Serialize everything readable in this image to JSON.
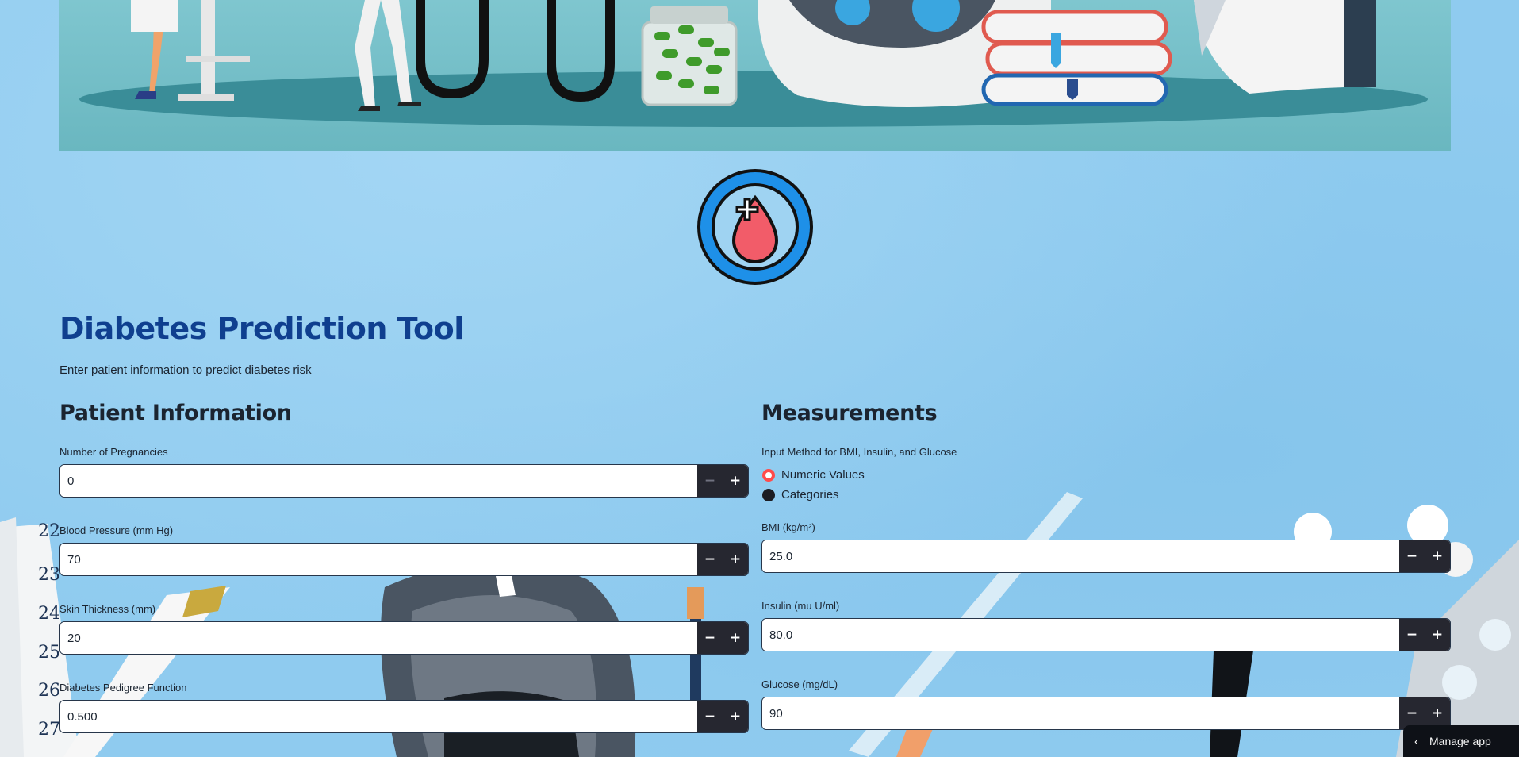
{
  "header": {
    "title": "Diabetes Prediction Tool",
    "subtitle": "Enter patient information to predict diabetes risk"
  },
  "patient": {
    "heading": "Patient Information",
    "pregnancies": {
      "label": "Number of Pregnancies",
      "value": "0"
    },
    "blood_pressure": {
      "label": "Blood Pressure (mm Hg)",
      "value": "70"
    },
    "skin_thickness": {
      "label": "Skin Thickness (mm)",
      "value": "20"
    },
    "pedigree": {
      "label": "Diabetes Pedigree Function",
      "value": "0.500"
    }
  },
  "measurements": {
    "heading": "Measurements",
    "input_method": {
      "label": "Input Method for BMI, Insulin, and Glucose",
      "options": [
        "Numeric Values",
        "Categories"
      ],
      "selected": "Numeric Values"
    },
    "bmi": {
      "label": "BMI (kg/m²)",
      "value": "25.0"
    },
    "insulin": {
      "label": "Insulin (mu U/ml)",
      "value": "80.0"
    },
    "glucose": {
      "label": "Glucose (mg/dL)",
      "value": "90"
    }
  },
  "stepper": {
    "minus": "−",
    "plus": "+"
  },
  "manage_app": {
    "label": "Manage app",
    "chevron": "‹"
  },
  "colors": {
    "title": "#0f3f8f",
    "background": "#8fcbef",
    "stepper": "#262730",
    "radio_selected": "#ff4b4b",
    "logo_ring": "#1e90e8",
    "logo_drop": "#f25c69"
  },
  "icons": [
    "blood-drop-plus-icon",
    "minus-icon",
    "plus-icon",
    "chevron-left-icon"
  ]
}
